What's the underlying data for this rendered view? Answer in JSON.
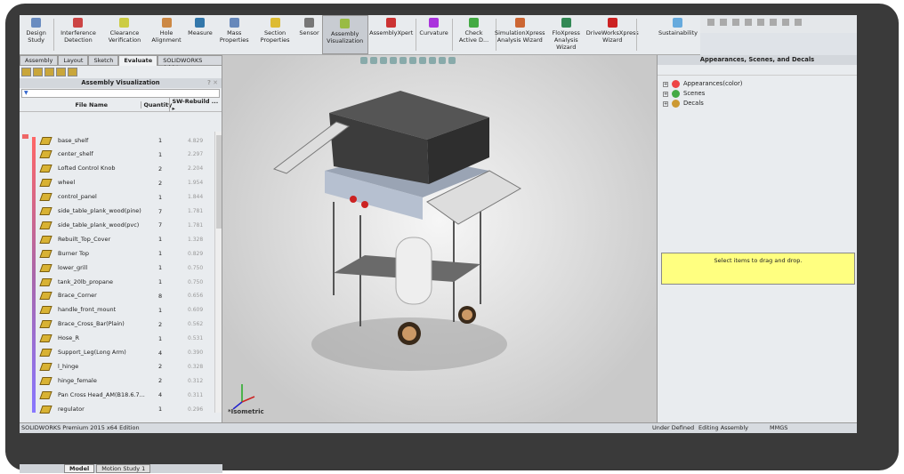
{
  "ribbon": {
    "buttons": [
      {
        "label": "Design Study",
        "color": "#6a8cc0"
      },
      {
        "label": "Interference Detection",
        "color": "#c44"
      },
      {
        "label": "Clearance Verification",
        "color": "#cc4"
      },
      {
        "label": "Hole Alignment",
        "color": "#c84"
      },
      {
        "label": "Measure",
        "color": "#37a"
      },
      {
        "label": "Mass Properties",
        "color": "#68b"
      },
      {
        "label": "Section Properties",
        "color": "#db3"
      },
      {
        "label": "Sensor",
        "color": "#777"
      },
      {
        "label": "Assembly Visualization",
        "color": "#9b4"
      },
      {
        "label": "AssemblyXpert",
        "color": "#c33"
      },
      {
        "label": "Curvature",
        "color": "#a3d"
      },
      {
        "label": "Check Active D...",
        "color": "#4a4"
      },
      {
        "label": "SimulationXpress Analysis Wizard",
        "color": "#c63"
      },
      {
        "label": "FloXpress Analysis Wizard",
        "color": "#385"
      },
      {
        "label": "DriveWorksXpress Wizard",
        "color": "#c22"
      },
      {
        "label": "Sustainability",
        "color": "#6ad"
      }
    ]
  },
  "tabs": [
    "Assembly",
    "Layout",
    "Sketch",
    "Evaluate",
    "SOLIDWORKS Add-Ins"
  ],
  "panel": {
    "title": "Assembly Visualization",
    "help": "? ✕",
    "columns": {
      "file": "File Name",
      "qty": "Quantity",
      "sw": "SW-Rebuild ... ▸"
    }
  },
  "rows": [
    {
      "name": "base_shelf",
      "qty": "1",
      "value": 4.829
    },
    {
      "name": "center_shelf",
      "qty": "1",
      "value": 2.297
    },
    {
      "name": "Lofted Control Knob",
      "qty": "2",
      "value": 2.204
    },
    {
      "name": "wheel",
      "qty": "2",
      "value": 1.954
    },
    {
      "name": "control_panel",
      "qty": "1",
      "value": 1.844
    },
    {
      "name": "side_table_plank_wood(pine)",
      "qty": "7",
      "value": 1.781
    },
    {
      "name": "side_table_plank_wood(pvc)",
      "qty": "7",
      "value": 1.781
    },
    {
      "name": "Rebuilt_Top_Cover",
      "qty": "1",
      "value": 1.328
    },
    {
      "name": "Burner Top",
      "qty": "1",
      "value": 0.829
    },
    {
      "name": "lower_grill",
      "qty": "1",
      "value": 0.75
    },
    {
      "name": "tank_20lb_propane",
      "qty": "1",
      "value": 0.75
    },
    {
      "name": "Brace_Corner",
      "qty": "8",
      "value": 0.656
    },
    {
      "name": "handle_front_mount",
      "qty": "1",
      "value": 0.609
    },
    {
      "name": "Brace_Cross_Bar(Plain)",
      "qty": "2",
      "value": 0.562
    },
    {
      "name": "Hose_R",
      "qty": "1",
      "value": 0.531
    },
    {
      "name": "Support_Leg(Long Arm)",
      "qty": "4",
      "value": 0.39
    },
    {
      "name": "l_hinge",
      "qty": "2",
      "value": 0.328
    },
    {
      "name": "hinge_female",
      "qty": "2",
      "value": 0.312
    },
    {
      "name": "Pan Cross Head_AM(B18.6.7...",
      "qty": "4",
      "value": 0.311
    },
    {
      "name": "regulator",
      "qty": "1",
      "value": 0.296
    }
  ],
  "bottom_tabs": [
    "Model",
    "Motion Study 1"
  ],
  "viewport": {
    "view_label": "*Isometric"
  },
  "right": {
    "title": "Appearances, Scenes, and Decals",
    "tree": [
      {
        "label": "Appearances(color)",
        "color": "#e44"
      },
      {
        "label": "Scenes",
        "color": "#4a4"
      },
      {
        "label": "Decals",
        "color": "#c93"
      }
    ],
    "drop_hint": "Select items to drag and drop."
  },
  "status": {
    "edition": "SOLIDWORKS Premium 2015 x64 Edition",
    "state": "Under Defined",
    "mode": "Editing Assembly",
    "units": "MMGS"
  }
}
